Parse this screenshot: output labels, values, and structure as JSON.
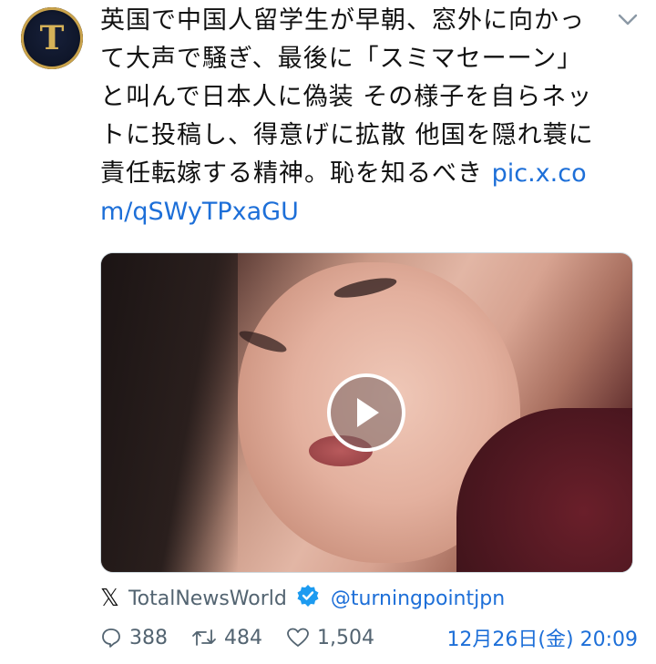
{
  "avatar": {
    "letter": "T"
  },
  "tweet": {
    "text": "英国で中国人留学生が早朝、窓外に向かって大声で騒ぎ、最後に「スミマセーーン」と叫んで日本人に偽装 その様子を自らネットに投稿し、得意げに拡散 他国を隠れ蓑に責任転嫁する精神。恥を知るべき ",
    "link": "pic.x.com/qSWyTPxaGU"
  },
  "source": {
    "name": "TotalNewsWorld",
    "handle": "@turningpointjpn"
  },
  "stats": {
    "replies": "388",
    "retweets": "484",
    "likes": "1,504",
    "date": "12月26日(金) 20:09"
  },
  "colors": {
    "link": "#1d6fd8",
    "muted": "#536471",
    "verified": "#1d9bf0"
  }
}
